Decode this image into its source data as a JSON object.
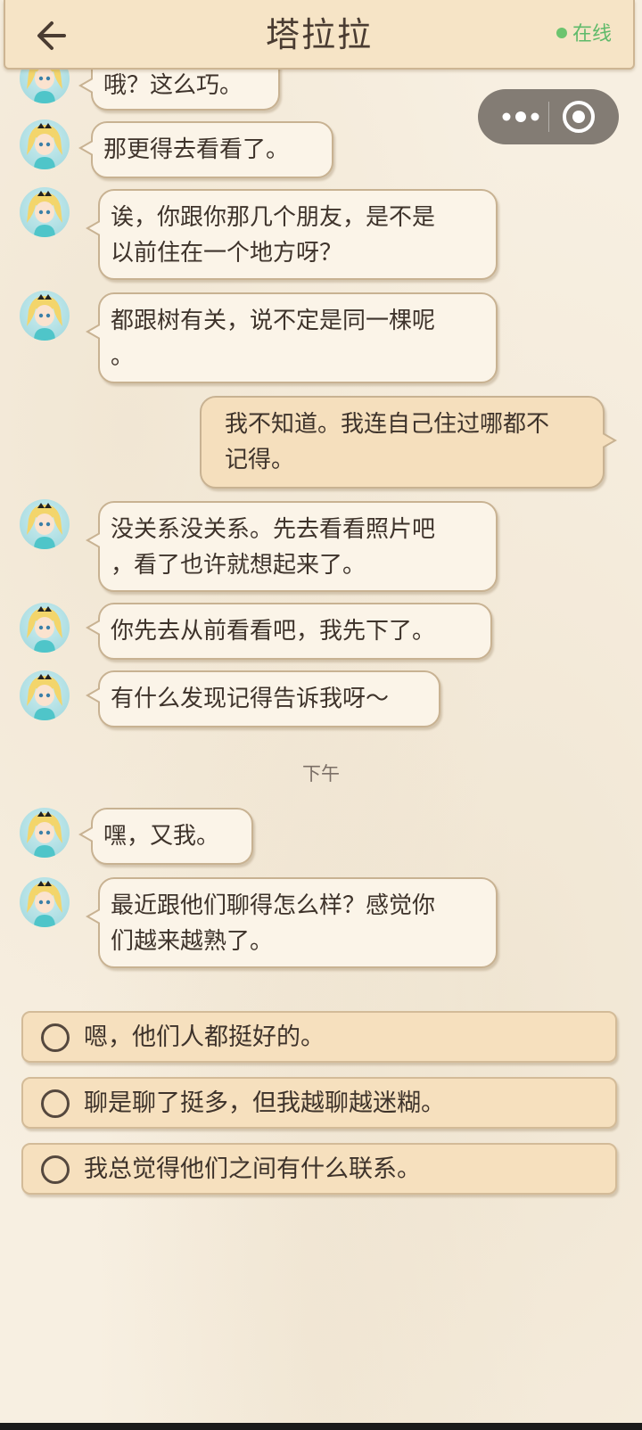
{
  "header": {
    "title": "塔拉拉",
    "status": "在线",
    "back_icon": "arrow-left-icon"
  },
  "capsule": {
    "more_icon": "more-dots-icon",
    "close_icon": "target-circle-icon"
  },
  "messages": [
    {
      "side": "left",
      "text": "哦？这么巧。"
    },
    {
      "side": "left",
      "text": "那更得去看看了。"
    },
    {
      "side": "left",
      "lines": [
        "诶，你跟你那几个朋友，是不是",
        "以前住在一个地方呀？"
      ]
    },
    {
      "side": "left",
      "lines": [
        "都跟树有关，说不定是同一棵呢",
        "。"
      ]
    },
    {
      "side": "right",
      "lines": [
        "我不知道。我连自己住过哪都不",
        "记得。"
      ]
    },
    {
      "side": "left",
      "lines": [
        "没关系没关系。先去看看照片吧",
        "，看了也许就想起来了。"
      ]
    },
    {
      "side": "left",
      "text": "你先去从前看看吧，我先下了。"
    },
    {
      "side": "left",
      "text": "有什么发现记得告诉我呀～"
    },
    {
      "side": "left",
      "text": "嘿，又我。"
    },
    {
      "side": "left",
      "lines": [
        "最近跟他们聊得怎么样？感觉你",
        "们越来越熟了。"
      ]
    }
  ],
  "time_separator": "下午",
  "options": [
    {
      "label": "嗯，他们人都挺好的。"
    },
    {
      "label": "聊是聊了挺多，但我越聊越迷糊。"
    },
    {
      "label": "我总觉得他们之间有什么联系。"
    }
  ],
  "colors": {
    "background": "#f7efe1",
    "bubble": "#fbf4e8",
    "self_bubble": "#f5dfbd",
    "option": "#f6e0be",
    "online": "#6cc46f"
  }
}
